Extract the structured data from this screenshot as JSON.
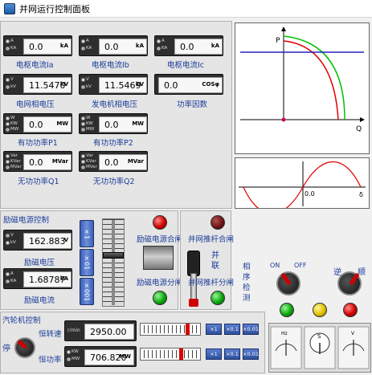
{
  "window": {
    "title": "并网运行控制面板"
  },
  "meters": [
    {
      "id": "ia",
      "value": "0.0",
      "unit": "kA",
      "radios": [
        "A",
        "KA"
      ],
      "selected": 1,
      "label": "电枢电流Ia"
    },
    {
      "id": "ib",
      "value": "0.0",
      "unit": "kA",
      "radios": [
        "A",
        "KA"
      ],
      "selected": 1,
      "label": "电枢电流Ib"
    },
    {
      "id": "ic",
      "value": "0.0",
      "unit": "kA",
      "radios": [
        "A",
        "KA"
      ],
      "selected": 1,
      "label": "电枢电流Ic"
    },
    {
      "id": "vgrid",
      "value": "11.5470",
      "unit": "kV",
      "radios": [
        "V",
        "kV"
      ],
      "selected": 1,
      "label": "电网相电压"
    },
    {
      "id": "vgen",
      "value": "11.5469",
      "unit": "kV",
      "radios": [
        "V",
        "kV"
      ],
      "selected": 1,
      "label": "发电机相电压"
    },
    {
      "id": "pf",
      "value": "0.0",
      "unit": "COSφ",
      "radios": [],
      "selected": -1,
      "label": "功率因数"
    },
    {
      "id": "p1",
      "value": "0.0",
      "unit": "MW",
      "radios": [
        "W",
        "KW",
        "MW"
      ],
      "selected": 2,
      "label": "有功功率P1"
    },
    {
      "id": "p2",
      "value": "0.0",
      "unit": "MW",
      "radios": [
        "W",
        "KW",
        "MW"
      ],
      "selected": 2,
      "label": "有功功率P2"
    },
    {
      "id": "q1",
      "value": "0.0",
      "unit": "MVar",
      "radios": [
        "Var",
        "KVar",
        "MVar"
      ],
      "selected": 2,
      "label": "无功功率Q1"
    },
    {
      "id": "q2",
      "value": "0.0",
      "unit": "MVar",
      "radios": [
        "Var",
        "KVar",
        "MVar"
      ],
      "selected": 2,
      "label": "无功功率Q2"
    }
  ],
  "pq_chart": {
    "ylabel": "P",
    "xlabel": "Q"
  },
  "wave_chart": {
    "origin_label": "0.0",
    "xlabel": "δ"
  },
  "excitation": {
    "title": "励磁电源控制",
    "voltage": {
      "value": "162.883",
      "unit": "V",
      "radios": [
        "V",
        "kV"
      ],
      "selected": 0,
      "label": "励磁电压"
    },
    "current": {
      "value": "1.68787",
      "unit": "kA",
      "radios": [
        "A",
        "KA"
      ],
      "selected": 1,
      "label": "励磁电流"
    },
    "step_buttons": [
      "×1",
      "×01",
      "×001"
    ],
    "close_label": "励磁电源合闸",
    "open_label": "励磁电源分闸",
    "slider_level": 0.6
  },
  "grid": {
    "close_label": "并网推杆合闸",
    "open_label": "并网推杆分闸",
    "parallel_label": "并联"
  },
  "phase": {
    "label": "相序检测",
    "on_label": "ON",
    "off_label": "OFF",
    "reverse_label": "逆",
    "forward_label": "顺"
  },
  "turbine": {
    "title": "汽轮机控制",
    "stop_label": "停",
    "speed": {
      "label": "恒转速",
      "unit_prefix": "r/min",
      "value": "2950.00",
      "radios": [],
      "selected": -1
    },
    "power": {
      "label": "恒功率",
      "unit": "MW",
      "value": "706.820",
      "radios": [
        "KW",
        "MW"
      ],
      "selected": 1
    },
    "speed_scale_level": 0.82,
    "power_scale_level": 0.68,
    "multipliers": [
      "×1",
      "×0.1",
      "×0.01"
    ]
  },
  "gauges": {
    "hz": "Hz",
    "s": "S",
    "v": "V"
  },
  "colors": {
    "panel_label": "#1a3c99",
    "lamp_red": "#d10000",
    "lamp_green": "#0aa60a",
    "lamp_yellow": "#e0c000",
    "button_blue": "#3b5fb6"
  }
}
